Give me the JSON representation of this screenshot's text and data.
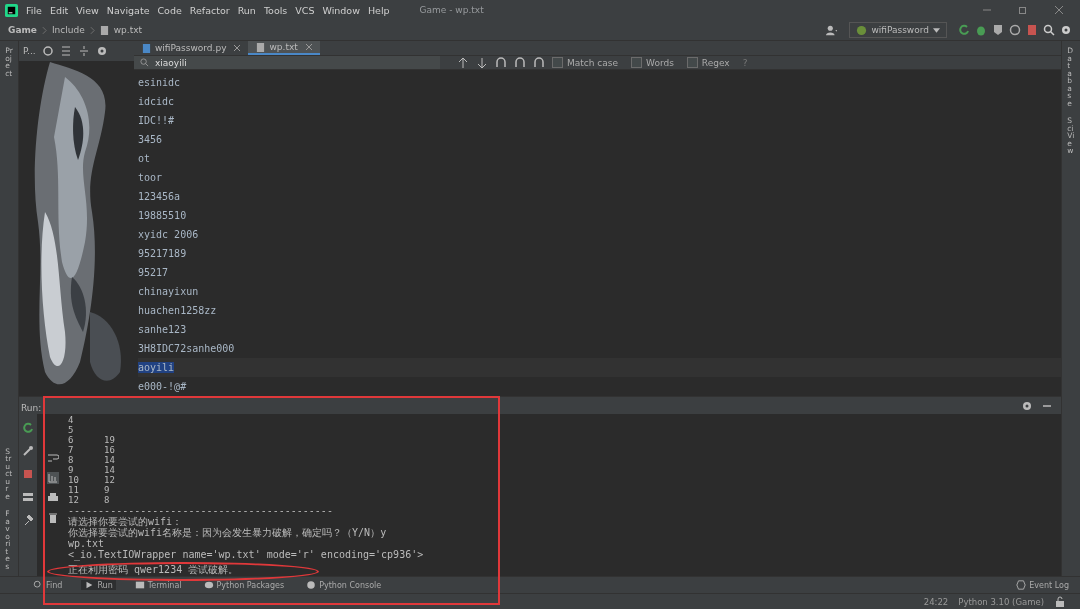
{
  "menu": [
    "File",
    "Edit",
    "View",
    "Navigate",
    "Code",
    "Refactor",
    "Run",
    "Tools",
    "VCS",
    "Window",
    "Help"
  ],
  "window": {
    "title": "Game - wp.txt"
  },
  "breadcrumbs": [
    "Game",
    "Include",
    "wp.txt"
  ],
  "run_config": "wifiPassword",
  "project_header": "P...",
  "tabs": [
    {
      "label": "wifiPassword.py",
      "kind": "python",
      "selected": false
    },
    {
      "label": "wp.txt",
      "kind": "text",
      "selected": true
    }
  ],
  "search": {
    "value": "xiaoyili",
    "options": [
      {
        "label": "Match case",
        "checked": false
      },
      {
        "label": "Words",
        "checked": false
      },
      {
        "label": "Regex",
        "checked": false
      }
    ],
    "help": "?"
  },
  "left_strip": [
    "Project",
    "Structure",
    "Favorites"
  ],
  "right_strip": [
    "Database",
    "SciView"
  ],
  "editor_lines": [
    {
      "text": "esinidc",
      "selected": false
    },
    {
      "text": "idcidc",
      "selected": false
    },
    {
      "text": "IDC!!#",
      "selected": false
    },
    {
      "text": "3456",
      "selected": false
    },
    {
      "text": "ot",
      "selected": false
    },
    {
      "text": "toor",
      "selected": false
    },
    {
      "text": "123456a",
      "selected": false
    },
    {
      "text": "19885510",
      "selected": false
    },
    {
      "text": "xyidc 2006",
      "selected": false
    },
    {
      "text": "95217189",
      "selected": false
    },
    {
      "text": "95217",
      "selected": false
    },
    {
      "text": "chinayixun",
      "selected": false
    },
    {
      "text": "huachen1258zz",
      "selected": false
    },
    {
      "text": "sanhe123",
      "selected": false
    },
    {
      "text": "3H8IDC72sanhe000",
      "selected": false
    },
    {
      "text": "aoyili",
      "selected": true
    },
    {
      "text": "e000-!@#",
      "selected": false
    }
  ],
  "run_panel": {
    "label": "Run:",
    "table_rows": [
      [
        "4"
      ],
      [
        "5"
      ],
      [
        "6",
        "19"
      ],
      [
        "7",
        "16"
      ],
      [
        "8",
        "14"
      ],
      [
        "9",
        "14"
      ],
      [
        "10",
        "12"
      ],
      [
        "11",
        "9"
      ],
      [
        "12",
        "8"
      ]
    ],
    "separator": "--------------------------------------------",
    "lines": [
      "请选择你要尝试的wifi：",
      "你选择要尝试的wifi名称是：因为会发生暴力破解，确定吗？（Y/N）y",
      "wp.txt",
      "<_io.TextIOWrapper name='wp.txt' mode='r' encoding='cp936'>",
      "正在利用密码 qwer1234 尝试破解。"
    ]
  },
  "bottom_tabs": [
    {
      "label": "Find",
      "kind": "search"
    },
    {
      "label": "Run",
      "kind": "run"
    },
    {
      "label": "Terminal",
      "kind": "terminal"
    },
    {
      "label": "Python Packages",
      "kind": "packages"
    },
    {
      "label": "Python Console",
      "kind": "console"
    }
  ],
  "event_log": "Event Log",
  "status_bar": {
    "position": "24:22",
    "interpreter": "Python 3.10 (Game)"
  }
}
